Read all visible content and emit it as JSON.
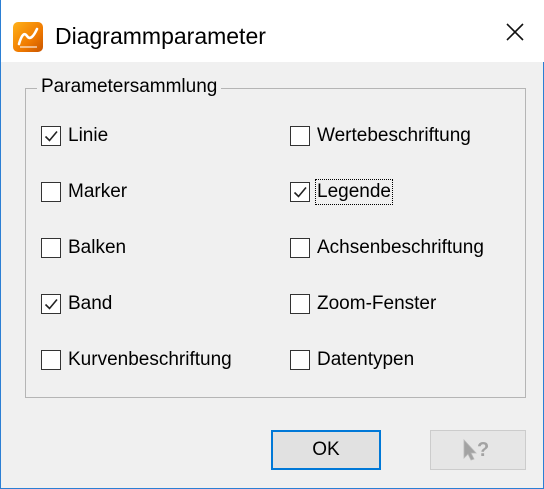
{
  "window": {
    "title": "Diagrammparameter",
    "icon": "app-logo-icon",
    "close_icon": "close-icon"
  },
  "group": {
    "legend": "Parametersammlung",
    "left_column": [
      {
        "label": "Linie",
        "checked": true
      },
      {
        "label": "Marker",
        "checked": false
      },
      {
        "label": "Balken",
        "checked": false
      },
      {
        "label": "Band",
        "checked": true
      },
      {
        "label": "Kurvenbeschriftung",
        "checked": false
      }
    ],
    "right_column": [
      {
        "label": "Wertebeschriftung",
        "checked": false
      },
      {
        "label": "Legende",
        "checked": true,
        "focused": true
      },
      {
        "label": "Achsenbeschriftung",
        "checked": false
      },
      {
        "label": "Zoom-Fenster",
        "checked": false
      },
      {
        "label": "Datentypen",
        "checked": false
      }
    ]
  },
  "buttons": {
    "ok_label": "OK",
    "help_icon": "context-help-icon",
    "help_enabled": false
  },
  "colors": {
    "accent": "#0078d7",
    "window_border": "#2b7fd4",
    "dialog_bg": "#f0f0f0",
    "disabled_icon": "#a0a0a0"
  }
}
